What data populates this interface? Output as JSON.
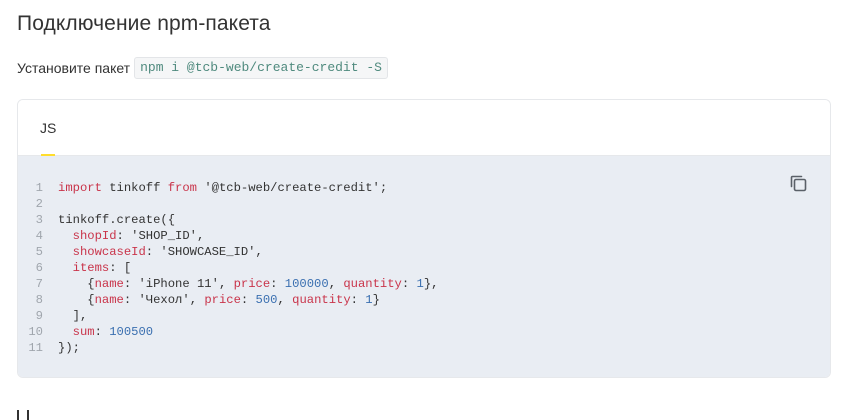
{
  "section": {
    "title": "Подключение npm-пакета",
    "install_label": "Установите пакет",
    "install_command": "npm i @tcb-web/create-credit -S"
  },
  "code_block": {
    "tabs": [
      {
        "label": "JS",
        "active": true
      }
    ],
    "copy_icon": "copy-icon",
    "lines": [
      {
        "n": "1",
        "tokens": [
          [
            "kw",
            "import"
          ],
          [
            "plain",
            " tinkoff "
          ],
          [
            "kw",
            "from"
          ],
          [
            "plain",
            " "
          ],
          [
            "str",
            "'@tcb-web/create-credit'"
          ],
          [
            "punc",
            ";"
          ]
        ]
      },
      {
        "n": "2",
        "tokens": []
      },
      {
        "n": "3",
        "tokens": [
          [
            "plain",
            "tinkoff.create({"
          ]
        ]
      },
      {
        "n": "4",
        "tokens": [
          [
            "plain",
            "  "
          ],
          [
            "prop",
            "shopId"
          ],
          [
            "punc",
            ": "
          ],
          [
            "str",
            "'SHOP_ID'"
          ],
          [
            "punc",
            ","
          ]
        ]
      },
      {
        "n": "5",
        "tokens": [
          [
            "plain",
            "  "
          ],
          [
            "prop",
            "showcaseId"
          ],
          [
            "punc",
            ": "
          ],
          [
            "str",
            "'SHOWCASE_ID'"
          ],
          [
            "punc",
            ","
          ]
        ]
      },
      {
        "n": "6",
        "tokens": [
          [
            "plain",
            "  "
          ],
          [
            "prop",
            "items"
          ],
          [
            "punc",
            ": ["
          ]
        ]
      },
      {
        "n": "7",
        "tokens": [
          [
            "plain",
            "    {"
          ],
          [
            "prop",
            "name"
          ],
          [
            "punc",
            ": "
          ],
          [
            "str",
            "'iPhone 11'"
          ],
          [
            "punc",
            ", "
          ],
          [
            "prop",
            "price"
          ],
          [
            "punc",
            ": "
          ],
          [
            "num",
            "100000"
          ],
          [
            "punc",
            ", "
          ],
          [
            "prop",
            "quantity"
          ],
          [
            "punc",
            ": "
          ],
          [
            "num",
            "1"
          ],
          [
            "punc",
            "},"
          ]
        ]
      },
      {
        "n": "8",
        "tokens": [
          [
            "plain",
            "    {"
          ],
          [
            "prop",
            "name"
          ],
          [
            "punc",
            ": "
          ],
          [
            "str",
            "'Чехол'"
          ],
          [
            "punc",
            ", "
          ],
          [
            "prop",
            "price"
          ],
          [
            "punc",
            ": "
          ],
          [
            "num",
            "500"
          ],
          [
            "punc",
            ", "
          ],
          [
            "prop",
            "quantity"
          ],
          [
            "punc",
            ": "
          ],
          [
            "num",
            "1"
          ],
          [
            "punc",
            "}"
          ]
        ]
      },
      {
        "n": "9",
        "tokens": [
          [
            "plain",
            "  ],"
          ]
        ]
      },
      {
        "n": "10",
        "tokens": [
          [
            "plain",
            "  "
          ],
          [
            "prop",
            "sum"
          ],
          [
            "punc",
            ": "
          ],
          [
            "num",
            "100500"
          ]
        ]
      },
      {
        "n": "11",
        "tokens": [
          [
            "plain",
            "});"
          ]
        ]
      }
    ]
  },
  "colors": {
    "accent_tab_underline": "#ffdd2d",
    "code_background": "#e9edf3",
    "keyword": "#c9344a",
    "number": "#3a6fb0",
    "install_command_text": "#4f8a7e"
  }
}
